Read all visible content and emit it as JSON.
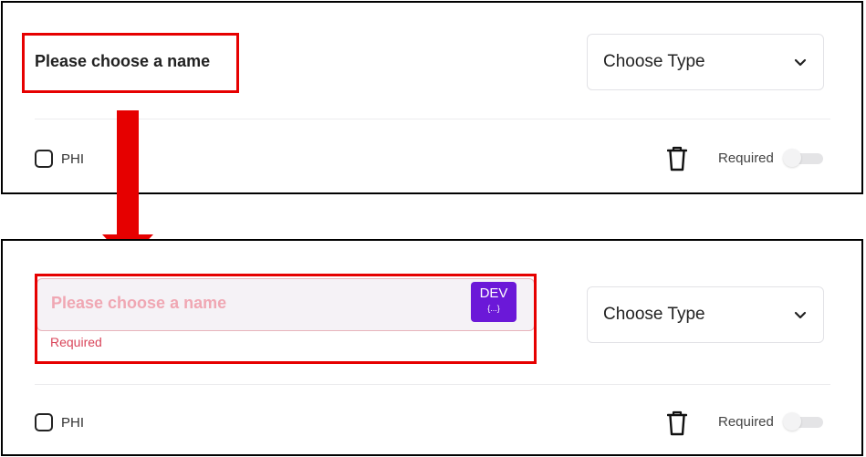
{
  "top_panel": {
    "name_label": "Please choose a name",
    "type_select": {
      "selected": "Choose Type"
    },
    "phi_label": "PHI",
    "required_label": "Required"
  },
  "bottom_panel": {
    "name_input": {
      "placeholder": "Please choose a name",
      "error": "Required"
    },
    "dev_badge": {
      "label": "DEV",
      "sub_label": "{...}"
    },
    "type_select": {
      "selected": "Choose Type"
    },
    "phi_label": "PHI",
    "required_label": "Required"
  },
  "colors": {
    "highlight": "#e60000",
    "dev_badge": "#6b18d8",
    "error": "#d9455a",
    "placeholder": "#f0a7b3"
  },
  "icons": [
    "chevron-down-icon",
    "trash-icon",
    "down-arrow-icon"
  ]
}
